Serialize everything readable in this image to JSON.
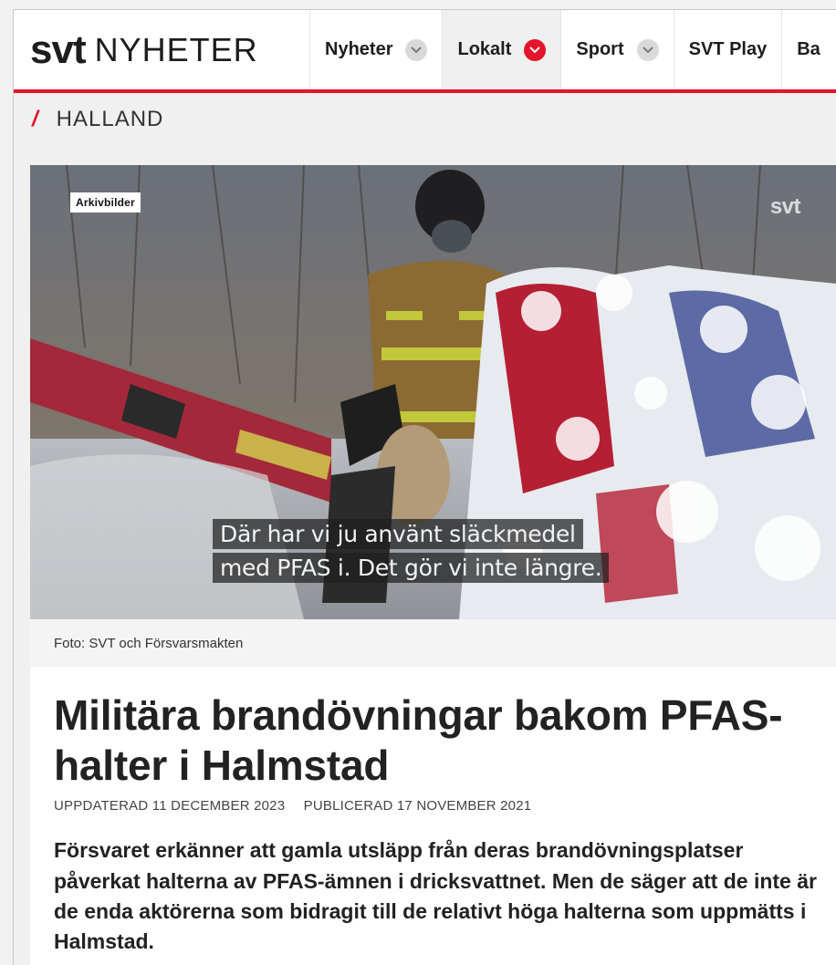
{
  "header": {
    "logo_mark": "svt",
    "logo_text": "NYHETER",
    "nav": [
      {
        "label": "Nyheter",
        "has_dropdown": true,
        "active": false
      },
      {
        "label": "Lokalt",
        "has_dropdown": true,
        "active": true
      },
      {
        "label": "Sport",
        "has_dropdown": true,
        "active": false
      },
      {
        "label": "SVT Play",
        "has_dropdown": false,
        "active": false
      },
      {
        "label": "Ba",
        "has_dropdown": false,
        "active": false
      }
    ]
  },
  "section": {
    "name": "HALLAND"
  },
  "media": {
    "badge": "Arkivbilder",
    "watermark": "svt",
    "subtitle_lines": [
      "Där har vi ju använt släckmedel",
      "med PFAS i. Det gör vi inte längre."
    ]
  },
  "caption": "Foto: SVT och Försvarsmakten",
  "article": {
    "headline": "Militära brandövningar bakom PFAS-halter i Halmstad",
    "updated": "UPPDATERAD 11 DECEMBER 2023",
    "published": "PUBLICERAD 17 NOVEMBER 2021",
    "lead": "Försvaret erkänner att gamla utsläpp från deras brandövningsplatser påverkat halterna av PFAS-ämnen i dricksvattnet. Men de säger att de inte är de enda aktörerna som bidragit till de relativt höga halterna som uppmätts i Halmstad."
  },
  "colors": {
    "brand_red": "#e3142b",
    "text": "#222222"
  }
}
